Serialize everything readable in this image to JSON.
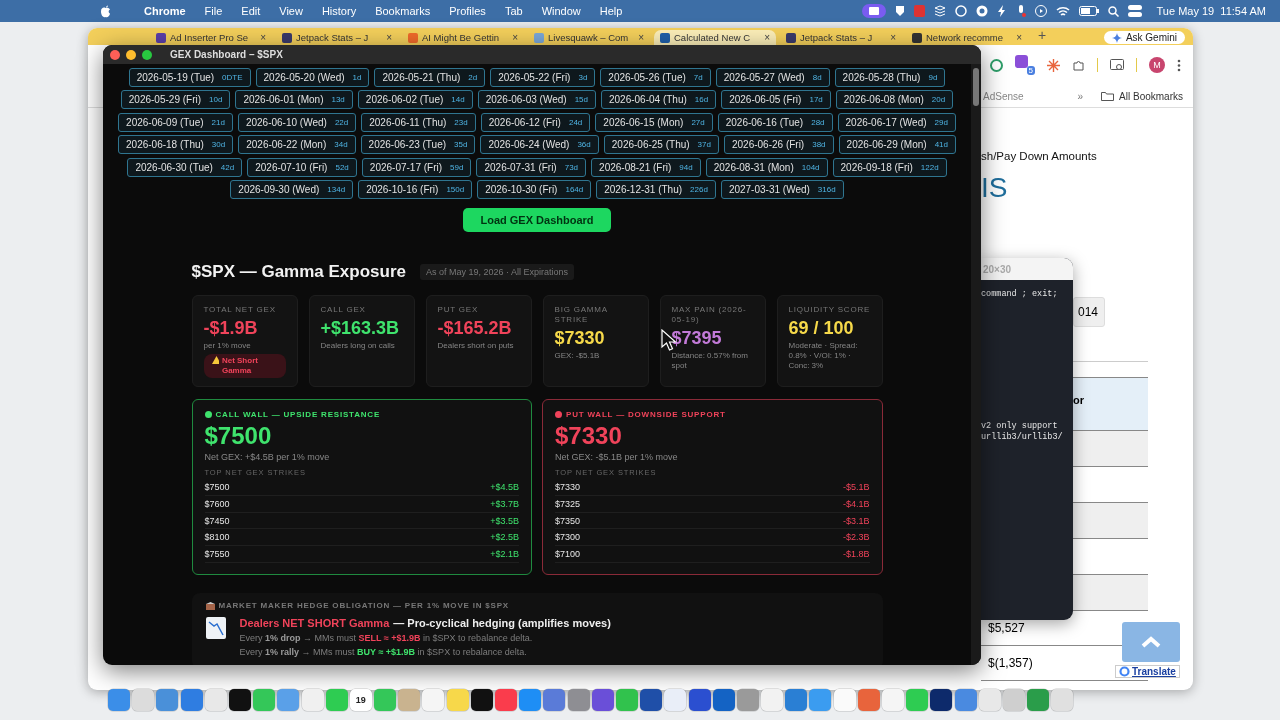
{
  "menu_bar": {
    "app": "Chrome",
    "items": [
      "File",
      "Edit",
      "View",
      "History",
      "Bookmarks",
      "Profiles",
      "Tab",
      "Window",
      "Help"
    ],
    "clock": "Tue May 19  11:54 AM"
  },
  "browser": {
    "tabs": [
      {
        "title": "Ad Inserter Pro Se",
        "close": "×",
        "color": "#5b3fa8",
        "selected": false
      },
      {
        "title": "Jetpack Stats – J",
        "close": "×",
        "color": "#3a3a6a",
        "selected": false
      },
      {
        "title": "AI Might Be Gettin",
        "close": "×",
        "color": "#f06a2a",
        "selected": false
      },
      {
        "title": "Livesquawk – Com",
        "close": "×",
        "color": "#7aa7d8",
        "selected": false
      },
      {
        "title": "Calculated New C",
        "close": "×",
        "color": "#1f5fa8",
        "selected": true
      },
      {
        "title": "Jetpack Stats – J",
        "close": "×",
        "color": "#3a3a6a",
        "selected": false
      },
      {
        "title": "Network recomme",
        "close": "×",
        "color": "#333333",
        "selected": false
      }
    ],
    "new_tab": "+",
    "ask_button": "Ask Gemini",
    "profile_initial": "M",
    "extension_badge": "5",
    "bookmarks": [
      "AdSense"
    ],
    "bookmarks_more": "»",
    "all_bookmarks": "All Bookmarks",
    "page": {
      "subtitle": "sh/Pay Down Amounts",
      "heading": "IS",
      "year_button": "014",
      "table_header": "or",
      "values": [
        "$5,527",
        "$(1,357)"
      ],
      "translate": "Translate"
    }
  },
  "terminal": {
    "title": "20×30",
    "lines": [
      "command ; exit;",
      "v2 only support",
      "urllib3/urllib3/"
    ]
  },
  "dashboard": {
    "window_title": "GEX Dashboard – $SPX",
    "expirations": [
      [
        {
          "date": "2026-05-19 (Tue)",
          "dte": "0DTE"
        },
        {
          "date": "2026-05-20 (Wed)",
          "dte": "1d"
        },
        {
          "date": "2026-05-21 (Thu)",
          "dte": "2d"
        },
        {
          "date": "2026-05-22 (Fri)",
          "dte": "3d"
        },
        {
          "date": "2026-05-26 (Tue)",
          "dte": "7d"
        },
        {
          "date": "2026-05-27 (Wed)",
          "dte": "8d"
        },
        {
          "date": "2026-05-28 (Thu)",
          "dte": "9d"
        }
      ],
      [
        {
          "date": "2026-05-29 (Fri)",
          "dte": "10d"
        },
        {
          "date": "2026-06-01 (Mon)",
          "dte": "13d"
        },
        {
          "date": "2026-06-02 (Tue)",
          "dte": "14d"
        },
        {
          "date": "2026-06-03 (Wed)",
          "dte": "15d"
        },
        {
          "date": "2026-06-04 (Thu)",
          "dte": "16d"
        },
        {
          "date": "2026-06-05 (Fri)",
          "dte": "17d"
        },
        {
          "date": "2026-06-08 (Mon)",
          "dte": "20d"
        }
      ],
      [
        {
          "date": "2026-06-09 (Tue)",
          "dte": "21d"
        },
        {
          "date": "2026-06-10 (Wed)",
          "dte": "22d"
        },
        {
          "date": "2026-06-11 (Thu)",
          "dte": "23d"
        },
        {
          "date": "2026-06-12 (Fri)",
          "dte": "24d"
        },
        {
          "date": "2026-06-15 (Mon)",
          "dte": "27d"
        },
        {
          "date": "2026-06-16 (Tue)",
          "dte": "28d"
        },
        {
          "date": "2026-06-17 (Wed)",
          "dte": "29d"
        }
      ],
      [
        {
          "date": "2026-06-18 (Thu)",
          "dte": "30d"
        },
        {
          "date": "2026-06-22 (Mon)",
          "dte": "34d"
        },
        {
          "date": "2026-06-23 (Tue)",
          "dte": "35d"
        },
        {
          "date": "2026-06-24 (Wed)",
          "dte": "36d"
        },
        {
          "date": "2026-06-25 (Thu)",
          "dte": "37d"
        },
        {
          "date": "2026-06-26 (Fri)",
          "dte": "38d"
        },
        {
          "date": "2026-06-29 (Mon)",
          "dte": "41d"
        }
      ],
      [
        {
          "date": "2026-06-30 (Tue)",
          "dte": "42d"
        },
        {
          "date": "2026-07-10 (Fri)",
          "dte": "52d"
        },
        {
          "date": "2026-07-17 (Fri)",
          "dte": "59d"
        },
        {
          "date": "2026-07-31 (Fri)",
          "dte": "73d"
        },
        {
          "date": "2026-08-21 (Fri)",
          "dte": "94d"
        },
        {
          "date": "2026-08-31 (Mon)",
          "dte": "104d"
        },
        {
          "date": "2026-09-18 (Fri)",
          "dte": "122d"
        }
      ],
      [
        {
          "date": "2026-09-30 (Wed)",
          "dte": "134d"
        },
        {
          "date": "2026-10-16 (Fri)",
          "dte": "150d"
        },
        {
          "date": "2026-10-30 (Fri)",
          "dte": "164d"
        },
        {
          "date": "2026-12-31 (Thu)",
          "dte": "226d"
        },
        {
          "date": "2027-03-31 (Wed)",
          "dte": "316d"
        }
      ]
    ],
    "load_button": "Load GEX Dashboard",
    "title": "$SPX — Gamma Exposure",
    "as_of": "As of May 19, 2026 · All Expirations",
    "stats": [
      {
        "label": "TOTAL NET GEX",
        "value": "-$1.9B",
        "color": "#f0435a",
        "sub": "per 1% move",
        "badge": "Net Short Gamma"
      },
      {
        "label": "CALL GEX",
        "value": "+$163.3B",
        "color": "#3fe36d",
        "sub": "Dealers long on calls"
      },
      {
        "label": "PUT GEX",
        "value": "-$165.2B",
        "color": "#f0435a",
        "sub": "Dealers short on puts"
      },
      {
        "label": "BIG GAMMA STRIKE",
        "value": "$7330",
        "color": "#f6d94a",
        "sub": "GEX: -$5.1B"
      },
      {
        "label": "MAX PAIN (2026-05-19)",
        "value": "$7395",
        "color": "#c27ad8",
        "sub": "Distance: 0.57% from spot"
      },
      {
        "label": "LIQUIDITY SCORE",
        "value": "69 / 100",
        "color": "#f6d94a",
        "sub": "Moderate · Spread: 0.8% · V/OI: 1% · Conc: 3%"
      }
    ],
    "walls": [
      {
        "kind": "call",
        "title": "CALL WALL — UPSIDE RESISTANCE",
        "value": "$7500",
        "net": "Net GEX: +$4.5B per 1% move",
        "strikes_label": "TOP NET GEX STRIKES",
        "strikes": [
          {
            "strike": "$7500",
            "gex": "+$4.5B"
          },
          {
            "strike": "$7600",
            "gex": "+$3.7B"
          },
          {
            "strike": "$7450",
            "gex": "+$3.5B"
          },
          {
            "strike": "$8100",
            "gex": "+$2.5B"
          },
          {
            "strike": "$7550",
            "gex": "+$2.1B"
          }
        ]
      },
      {
        "kind": "put",
        "title": "PUT WALL — DOWNSIDE SUPPORT",
        "value": "$7330",
        "net": "Net GEX: -$5.1B per 1% move",
        "strikes_label": "TOP NET GEX STRIKES",
        "strikes": [
          {
            "strike": "$7330",
            "gex": "-$5.1B"
          },
          {
            "strike": "$7325",
            "gex": "-$4.1B"
          },
          {
            "strike": "$7350",
            "gex": "-$3.1B"
          },
          {
            "strike": "$7300",
            "gex": "-$2.3B"
          },
          {
            "strike": "$7100",
            "gex": "-$1.8B"
          }
        ]
      }
    ],
    "hedge": {
      "title": "MARKET MAKER HEDGE OBLIGATION — PER 1% MOVE IN $SPX",
      "alert": "Dealers NET SHORT Gamma",
      "headline": "— Pro-cyclical hedging (amplifies moves)",
      "lines": [
        {
          "kind": "sell",
          "text": "Every **1% drop** → MMs must *SELL ≈ +$1.9B* in $SPX to rebalance delta."
        },
        {
          "kind": "buy",
          "text": "Every **1% rally** → MMs must *BUY ≈ +$1.9B* in $SPX to rebalance delta."
        }
      ]
    }
  },
  "dock": [
    {
      "color": "#3b8ee8"
    },
    {
      "color": "#dcdcdc"
    },
    {
      "color": "#4a90d9"
    },
    {
      "color": "#2f7de1"
    },
    {
      "color": "#e8e8e8"
    },
    {
      "color": "#111111"
    },
    {
      "color": "#34c759"
    },
    {
      "color": "#5aa0e8"
    },
    {
      "color": "#f0f0f0"
    },
    {
      "color": "#2ecc52"
    },
    {
      "color": "#ffffff",
      "label": "19"
    },
    {
      "color": "#34c759"
    },
    {
      "color": "#c9b38f"
    },
    {
      "color": "#f5f5f5"
    },
    {
      "color": "#f7d84a"
    },
    {
      "color": "#111111"
    },
    {
      "color": "#fa3c4c"
    },
    {
      "color": "#1e8ef5"
    },
    {
      "color": "#5a7bd8"
    },
    {
      "color": "#8e8e93"
    },
    {
      "color": "#6a4fd8"
    },
    {
      "color": "#31c24d"
    },
    {
      "color": "#1f4fa8"
    },
    {
      "color": "#e9eef8"
    },
    {
      "color": "#2b4fd0"
    },
    {
      "color": "#1463c4"
    },
    {
      "color": "#9a9a9a"
    },
    {
      "color": "#f2f2f2"
    },
    {
      "color": "#2a7fd4"
    },
    {
      "color": "#3b9cf0"
    },
    {
      "color": "#fafafa"
    },
    {
      "color": "#e8643c"
    },
    {
      "color": "#f5f5f5"
    },
    {
      "color": "#2ecc52"
    },
    {
      "color": "#0d2a6b"
    },
    {
      "color": "#4a8ae0"
    },
    {
      "color": "#e8e8e8"
    },
    {
      "color": "#cfcfcf"
    },
    {
      "color": "#2a9d4a"
    },
    {
      "color": "#e0e0e0"
    }
  ]
}
